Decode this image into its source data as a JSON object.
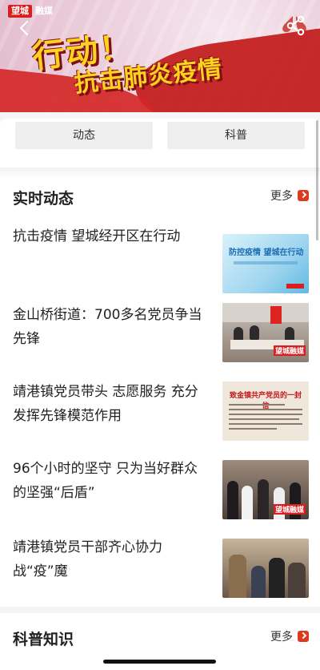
{
  "banner": {
    "logo_badge": "望城",
    "logo_text": "融媒",
    "title_line1": "行动！",
    "title_line2": "抗击肺炎疫情"
  },
  "tabs": [
    {
      "label": "动态"
    },
    {
      "label": "科普"
    }
  ],
  "sections": {
    "realtime": {
      "title": "实时动态",
      "more_label": "更多"
    },
    "science": {
      "title": "科普知识",
      "more_label": "更多"
    }
  },
  "articles": [
    {
      "title": "抗击疫情 望城经开区在行动",
      "thumb_text": "防控疫情 望城在行动"
    },
    {
      "title": "金山桥街道：700多名党员争当先锋",
      "thumb_text": "望城融媒"
    },
    {
      "title": "靖港镇党员带头 志愿服务 充分发挥先锋模范作用",
      "thumb_text": "致金镇共产党员的一封信"
    },
    {
      "title": "96个小时的坚守 只为当好群众的坚强“后盾”",
      "thumb_text": "望城融媒"
    },
    {
      "title": "靖港镇党员干部齐心协力战“疫”魔",
      "thumb_text": ""
    }
  ],
  "colors": {
    "accent": "#e03a1e",
    "brand_red": "#d81f1f",
    "title_yellow": "#ffd21f"
  }
}
